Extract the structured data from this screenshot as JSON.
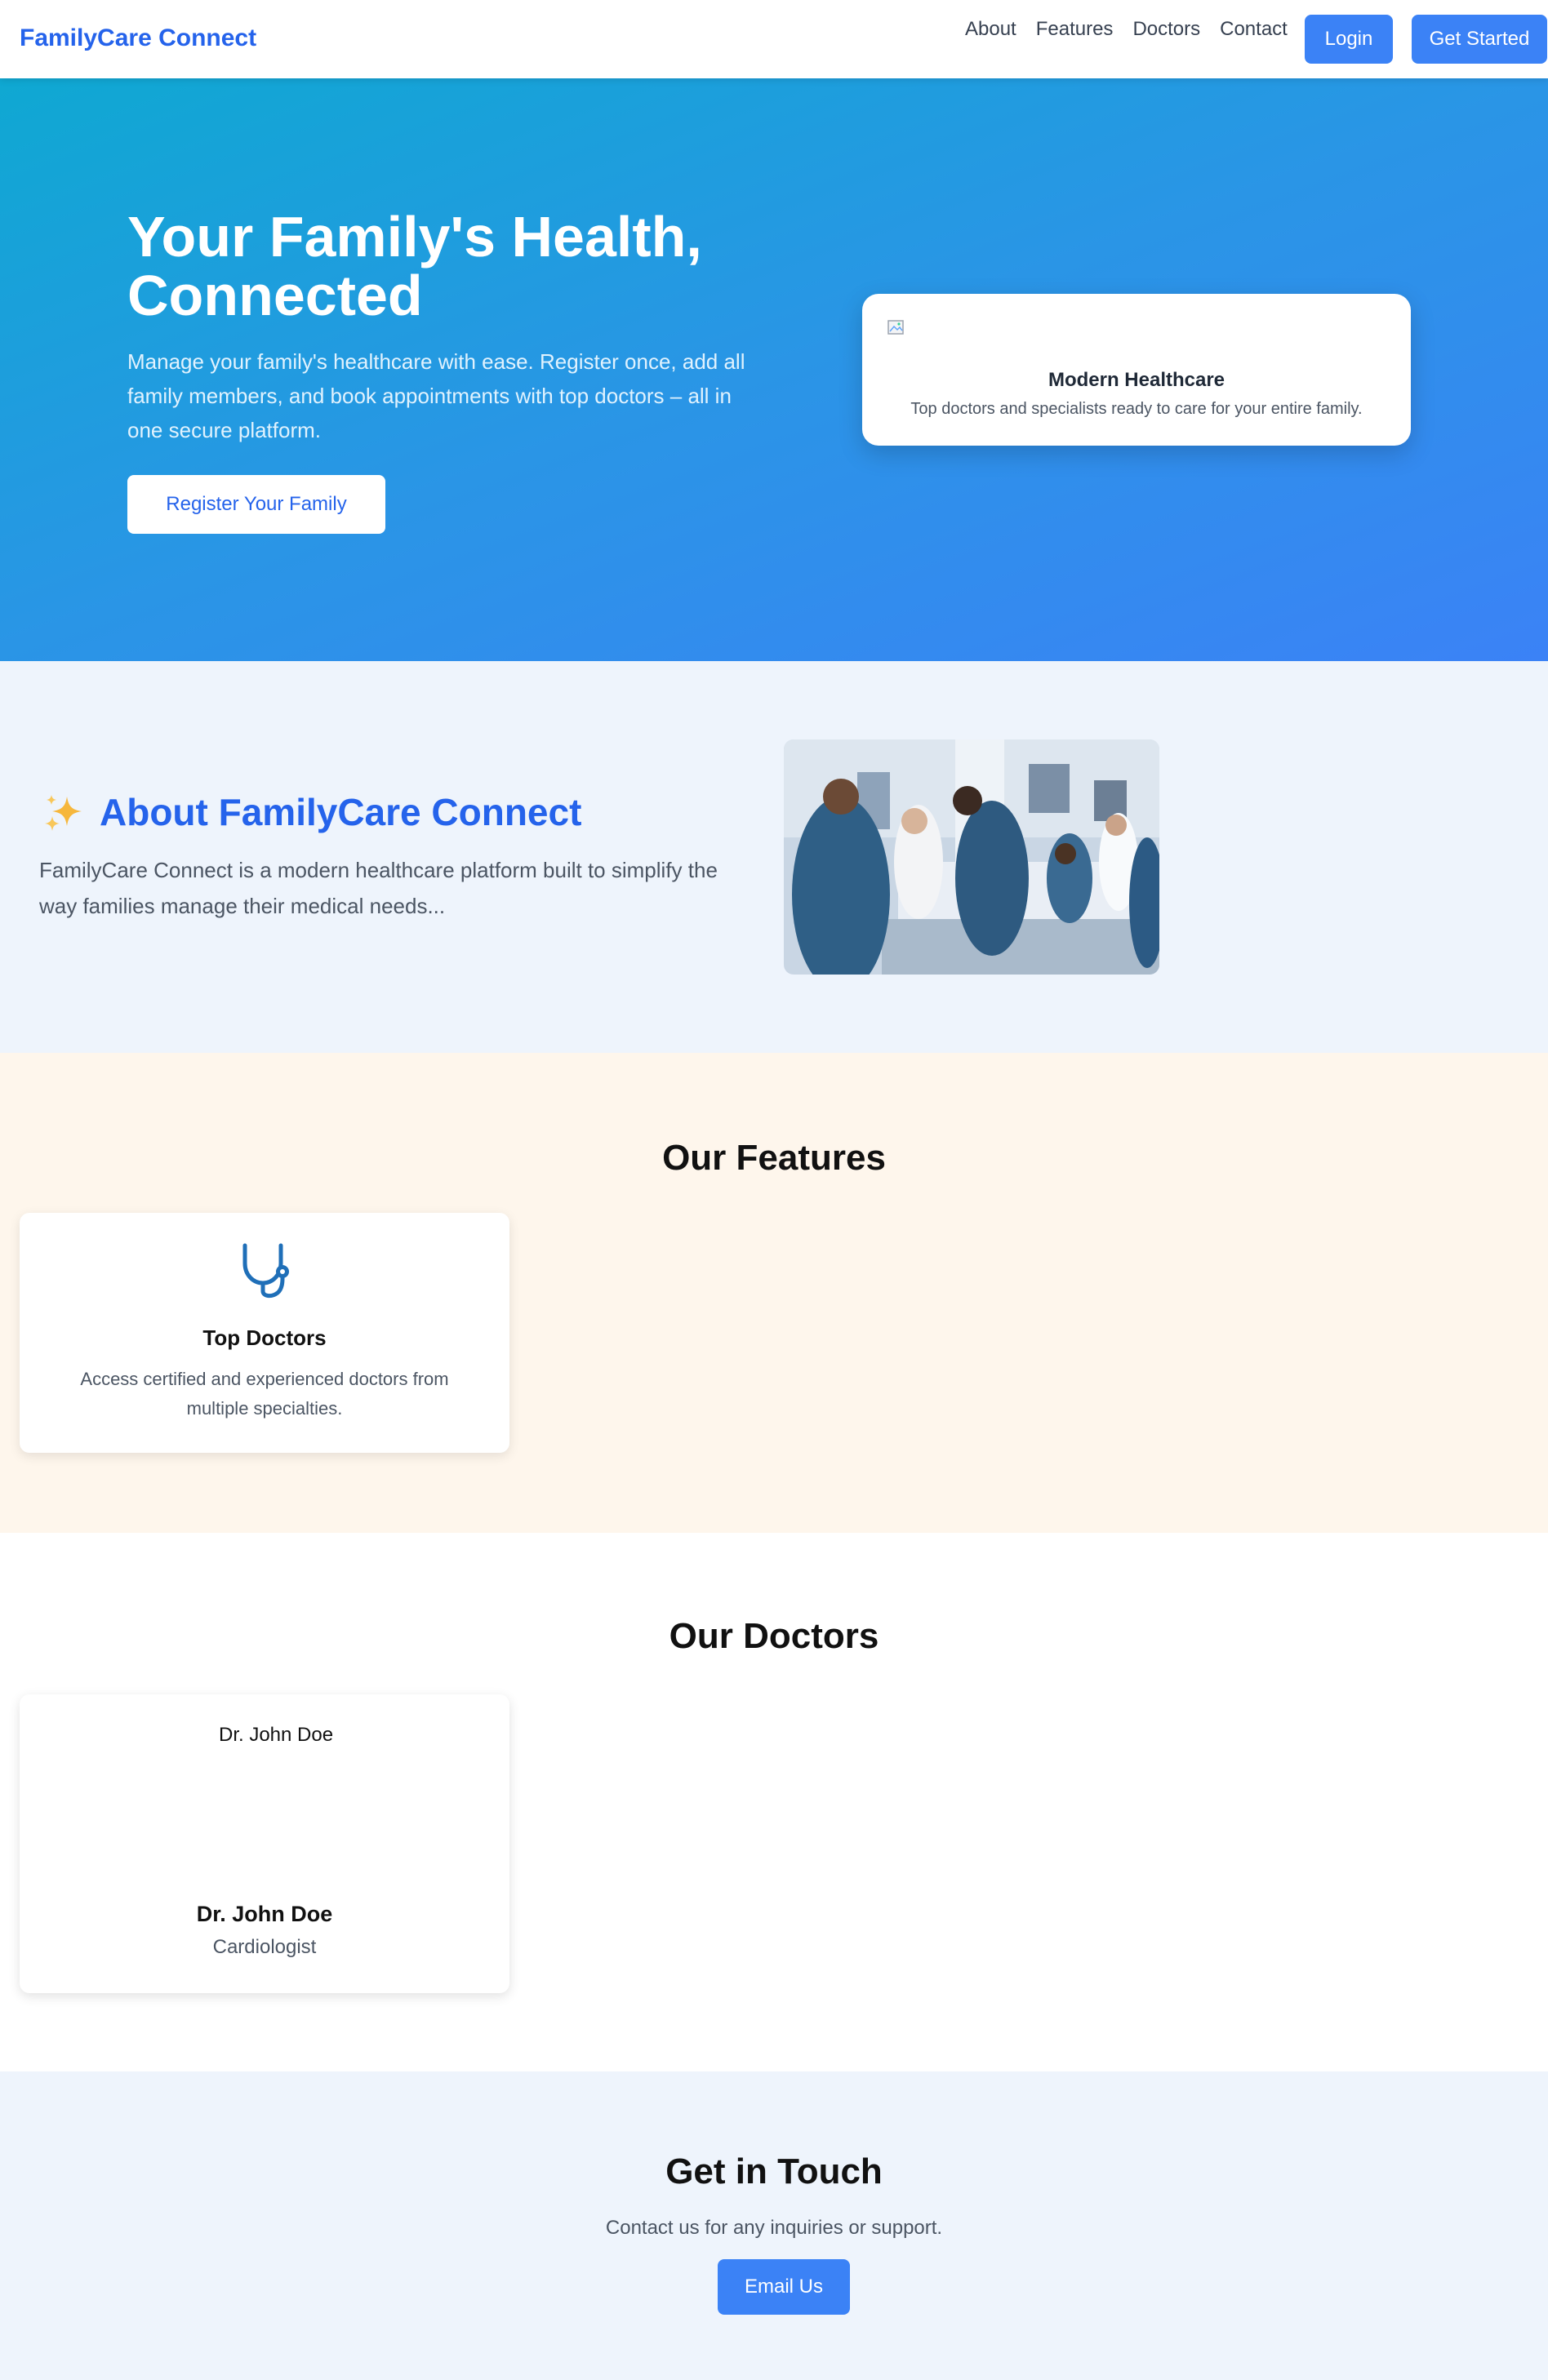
{
  "nav": {
    "brand": "FamilyCare Connect",
    "links": [
      "About",
      "Features",
      "Doctors",
      "Contact"
    ],
    "login_label": "Login",
    "get_started_label": "Get Started"
  },
  "hero": {
    "title": "Your Family's Health, Connected",
    "subtitle": "Manage your family's healthcare with ease. Register once, add all family members, and book appointments with top doctors – all in one secure platform.",
    "cta_label": "Register Your Family",
    "card": {
      "title": "Modern Healthcare",
      "subtitle": "Top doctors and specialists ready to care for your entire family."
    }
  },
  "about": {
    "icon": "sparkles-icon",
    "title": "About FamilyCare Connect",
    "text": "FamilyCare Connect is a modern healthcare platform built to simplify the way families manage their medical needs..."
  },
  "features": {
    "title": "Our Features",
    "items": [
      {
        "icon": "stethoscope-icon",
        "title": "Top Doctors",
        "text": "Access certified and experienced doctors from multiple specialties."
      }
    ]
  },
  "doctors": {
    "title": "Our Doctors",
    "items": [
      {
        "image_alt": "Dr. John Doe",
        "name": "Dr. John Doe",
        "specialty": "Cardiologist"
      }
    ]
  },
  "contact": {
    "title": "Get in Touch",
    "subtitle": "Contact us for any inquiries or support.",
    "button_label": "Email Us"
  },
  "colors": {
    "brand": "#2563eb",
    "button": "#3b82f6",
    "hero_gradient_start": "#0fa8d2",
    "hero_gradient_end": "#3b82f6",
    "about_bg": "#eef4fc",
    "features_bg": "#fef6ec"
  }
}
